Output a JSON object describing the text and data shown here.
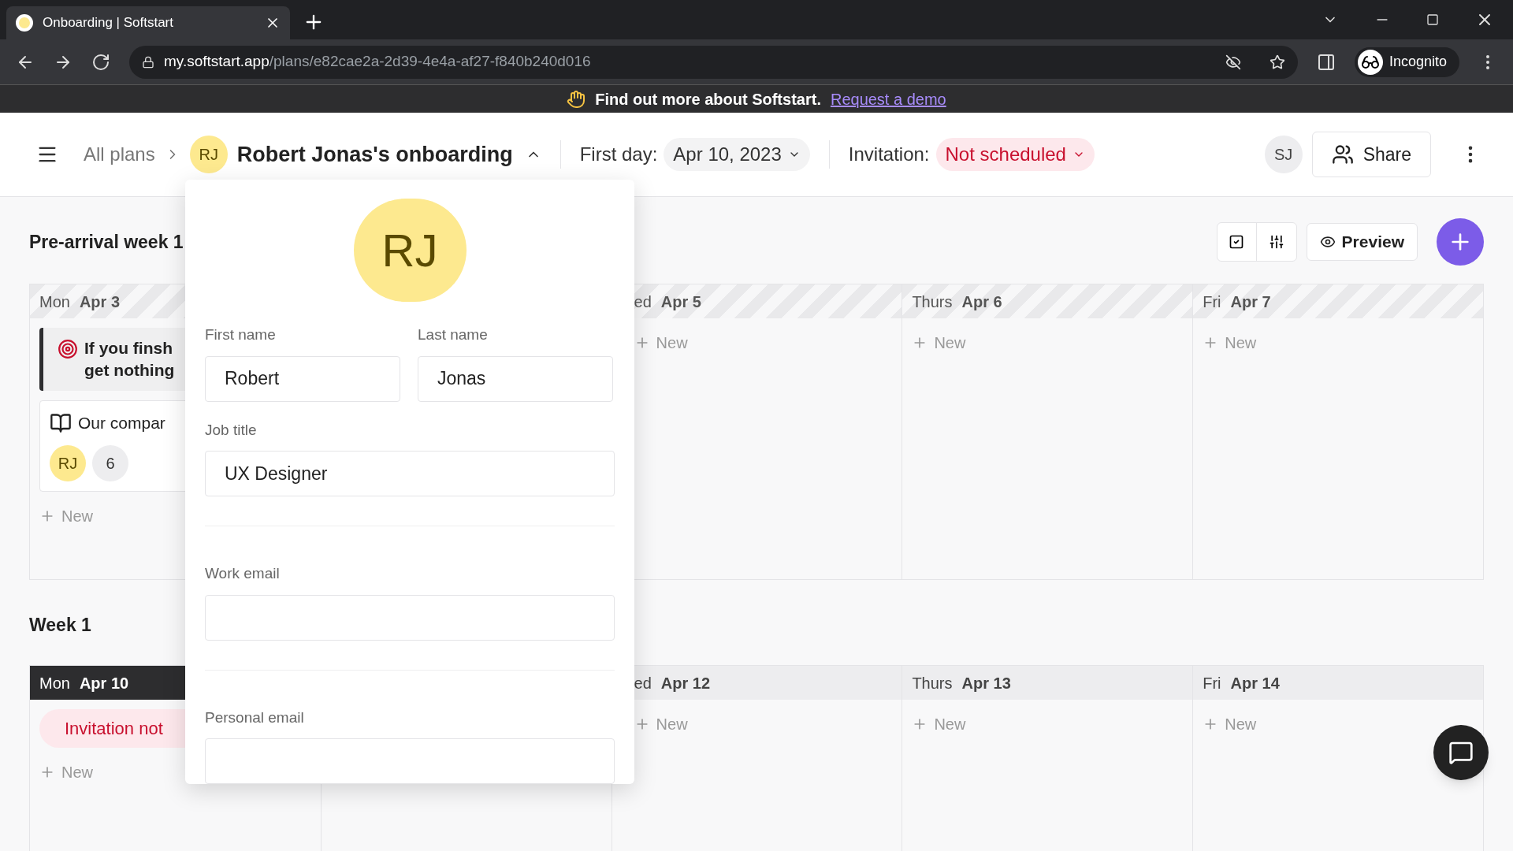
{
  "browser": {
    "tab_title": "Onboarding | Softstart",
    "url_host": "my.softstart.app",
    "url_path": "/plans/e82cae2a-2d39-4e4a-af27-f840b240d016",
    "profile": "Incognito"
  },
  "banner": {
    "text": "Find out more about Softstart.",
    "link": "Request a demo"
  },
  "header": {
    "breadcrumb": "All plans",
    "avatar": "RJ",
    "title": "Robert Jonas's onboarding",
    "first_day_label": "First day:",
    "first_day": "Apr 10, 2023",
    "invitation_label": "Invitation:",
    "invitation_status": "Not scheduled",
    "user": "SJ",
    "share": "Share"
  },
  "toolbar": {
    "preview": "Preview"
  },
  "weeks": [
    {
      "title": "Pre-arrival week 1",
      "pre_arrival": true,
      "days": [
        {
          "day": "Mon",
          "date": "Apr 3",
          "today": false,
          "new_label": "New",
          "items": [
            {
              "kind": "goal",
              "lines": [
                "If you finsh",
                "get nothing"
              ]
            },
            {
              "kind": "resource",
              "text": "Our compar",
              "avatar": "RJ",
              "count": "6"
            }
          ]
        },
        {
          "day": "ed",
          "date": "Apr 5",
          "today": false,
          "new_label": "New"
        },
        {
          "day": "Thurs",
          "date": "Apr 6",
          "today": false,
          "new_label": "New"
        },
        {
          "day": "Fri",
          "date": "Apr 7",
          "today": false,
          "new_label": "New"
        }
      ]
    },
    {
      "title": "Week 1",
      "pre_arrival": false,
      "days": [
        {
          "day": "Mon",
          "date": "Apr 10",
          "today": true,
          "new_label": "New",
          "items": [
            {
              "kind": "status",
              "text": "Invitation not"
            }
          ]
        },
        {
          "day": "ed",
          "date": "Apr 12",
          "today": false,
          "new_label": "New"
        },
        {
          "day": "Thurs",
          "date": "Apr 13",
          "today": false,
          "new_label": "New"
        },
        {
          "day": "Fri",
          "date": "Apr 14",
          "today": false,
          "new_label": "New"
        }
      ]
    }
  ],
  "popover": {
    "avatar": "RJ",
    "fields": [
      {
        "label": "First name",
        "value": "Robert",
        "half": true
      },
      {
        "label": "Last name",
        "value": "Jonas",
        "half": true
      },
      {
        "label": "Job title",
        "value": "UX Designer",
        "half": false
      },
      {
        "label": "Work email",
        "half": false
      },
      {
        "label": "Personal email",
        "half": false
      }
    ]
  }
}
